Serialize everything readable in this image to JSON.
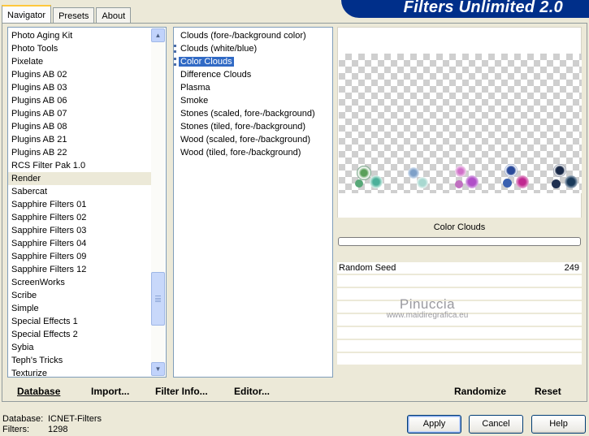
{
  "window": {
    "banner_title": "Filters Unlimited 2.0",
    "tabs": [
      {
        "label": "Navigator",
        "active": true
      },
      {
        "label": "Presets",
        "active": false
      },
      {
        "label": "About",
        "active": false
      }
    ]
  },
  "categories": {
    "selected": "Render",
    "items": [
      "Photo Aging Kit",
      "Photo Tools",
      "Pixelate",
      "Plugins AB 02",
      "Plugins AB 03",
      "Plugins AB 06",
      "Plugins AB 07",
      "Plugins AB 08",
      "Plugins AB 21",
      "Plugins AB 22",
      "RCS Filter Pak 1.0",
      "Render",
      "Sabercat",
      "Sapphire Filters 01",
      "Sapphire Filters 02",
      "Sapphire Filters 03",
      "Sapphire Filters 04",
      "Sapphire Filters 09",
      "Sapphire Filters 12",
      "ScreenWorks",
      "Scribe",
      "Simple",
      "Special Effects 1",
      "Special Effects 2",
      "Sybia",
      "Teph's Tricks",
      "Texturize"
    ]
  },
  "filters": {
    "selected": "Color Clouds",
    "items": [
      {
        "label": "Clouds (fore-/background color)",
        "marked": false
      },
      {
        "label": "Clouds (white/blue)",
        "marked": true
      },
      {
        "label": "Color Clouds",
        "marked": true
      },
      {
        "label": "Difference Clouds",
        "marked": false
      },
      {
        "label": "Plasma",
        "marked": false
      },
      {
        "label": "Smoke",
        "marked": false
      },
      {
        "label": "Stones (scaled, fore-/background)",
        "marked": false
      },
      {
        "label": "Stones (tiled, fore-/background)",
        "marked": false
      },
      {
        "label": "Wood (scaled, fore-/background)",
        "marked": false
      },
      {
        "label": "Wood (tiled, fore-/background)",
        "marked": false
      }
    ]
  },
  "preview": {
    "filter_name": "Color Clouds",
    "progress": 0,
    "params": [
      {
        "name": "Random Seed",
        "value": "249"
      },
      {
        "name": "",
        "value": ""
      },
      {
        "name": "",
        "value": ""
      },
      {
        "name": "",
        "value": ""
      },
      {
        "name": "",
        "value": ""
      },
      {
        "name": "",
        "value": ""
      },
      {
        "name": "",
        "value": ""
      },
      {
        "name": "",
        "value": ""
      }
    ],
    "watermark": {
      "line1": "Pinuccia",
      "line2": "www.maidiregrafica.eu"
    }
  },
  "bottom_links": {
    "database": "Database",
    "import": "Import...",
    "filter_info": "Filter Info...",
    "editor": "Editor...",
    "randomize": "Randomize",
    "reset": "Reset"
  },
  "status": {
    "database_label": "Database:",
    "database_value": "ICNET-Filters",
    "filters_label": "Filters:",
    "filters_value": "1298"
  },
  "buttons": {
    "apply": "Apply",
    "cancel": "Cancel",
    "help": "Help"
  },
  "colors": {
    "banner": "#002f8a",
    "selection": "#316ac5",
    "tab_accent": "#ffc83c"
  }
}
